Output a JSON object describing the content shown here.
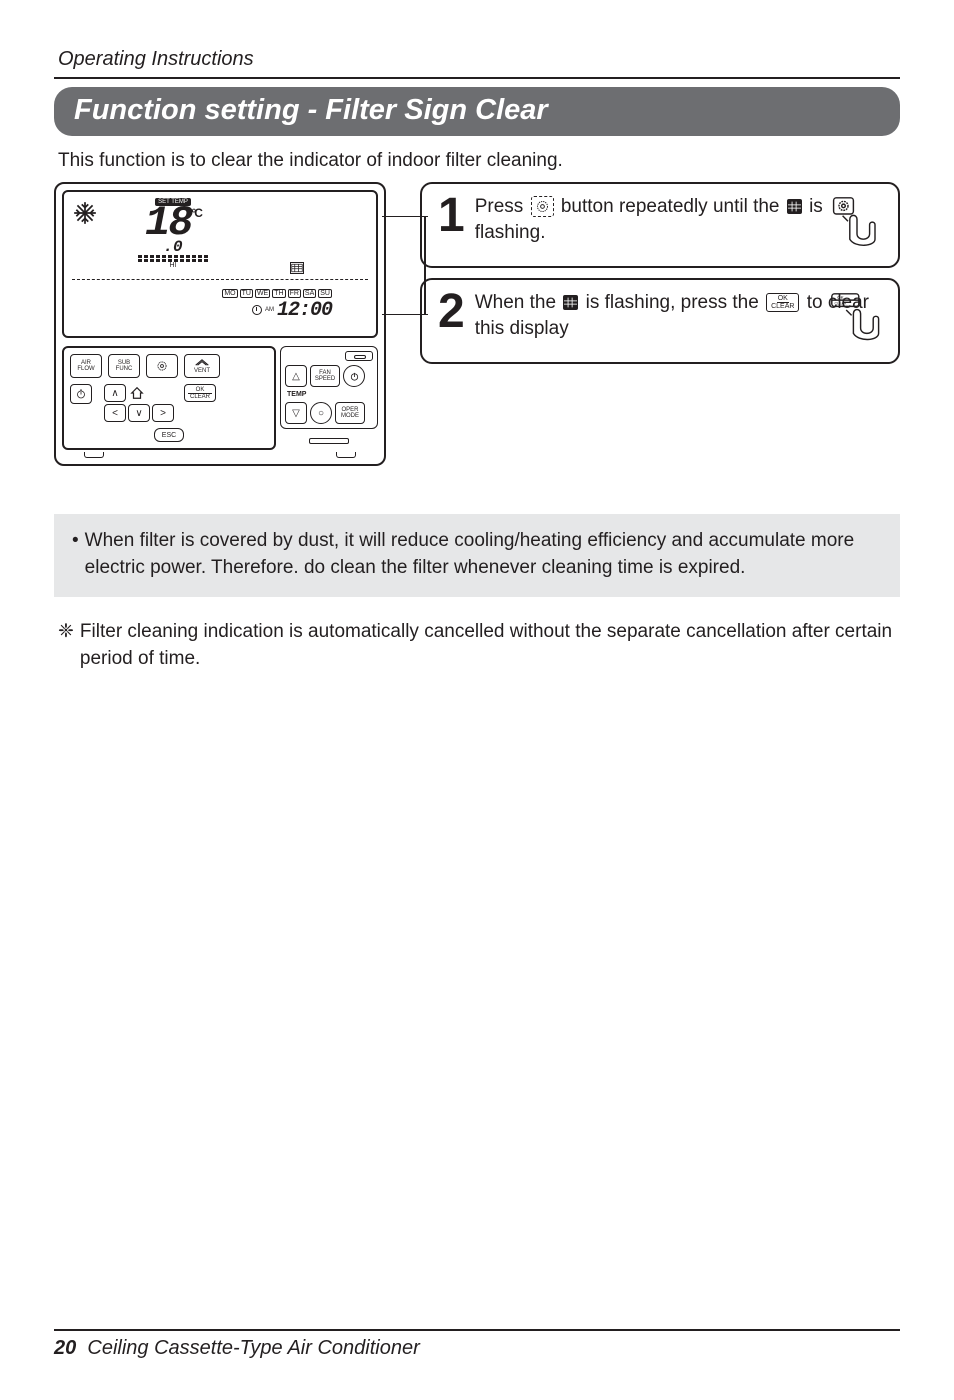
{
  "page": {
    "header": "Operating Instructions",
    "footer_page": "20",
    "footer_text": "Ceiling Cassette-Type Air Conditioner"
  },
  "banner": "Function setting - Filter Sign Clear",
  "intro": "This function is to clear the indicator of indoor filter cleaning.",
  "remote": {
    "set_temp_label": "SET TEMP",
    "temp_unit": "°C",
    "temp_value": "18",
    "temp_decimal": ".0",
    "hi_label": "HI",
    "days": "MO TU WE TH FR SA SU",
    "ampm": "AM",
    "time": "12:00",
    "btn_air_flow": "AIR\nFLOW",
    "btn_sub_func": "SUB\nFUNC",
    "btn_vent": "VENT",
    "btn_ok_clear_top": "OK",
    "btn_ok_clear_bot": "CLEAR",
    "btn_esc": "ESC",
    "btn_fan_speed": "FAN\nSPEED",
    "btn_temp": "TEMP",
    "btn_oper_mode": "OPER\nMODE"
  },
  "steps": [
    {
      "num": "1",
      "text_pre": "Press ",
      "text_mid": " button repeatedly until the ",
      "text_post": " is flashing."
    },
    {
      "num": "2",
      "text_pre": "When the ",
      "text_mid": " is flashing, press the ",
      "text_post": " to clear this display",
      "btn_ok": "OK",
      "btn_clear": "CLEAR"
    }
  ],
  "note": {
    "bullet": "•",
    "text": "When filter is covered by dust, it will reduce cooling/heating efficiency and accumulate more electric power. Therefore. do clean the filter whenever cleaning time is expired."
  },
  "flower": {
    "mark": "❈",
    "text": "Filter cleaning indication is automatically cancelled without the separate cancellation after certain period of time."
  }
}
